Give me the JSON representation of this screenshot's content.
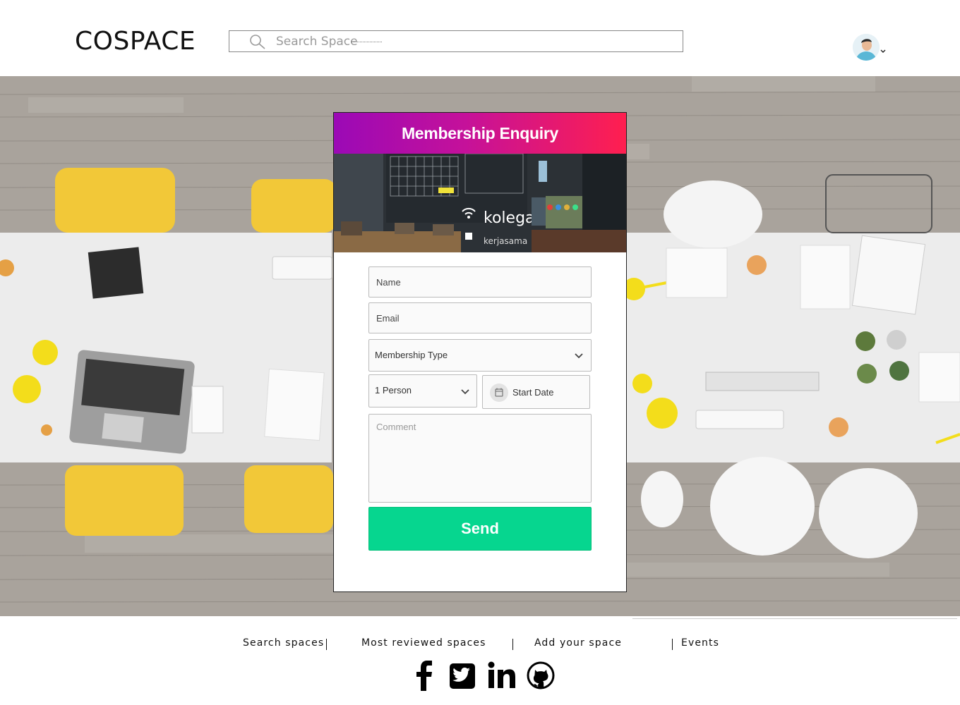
{
  "header": {
    "logo": "COSPACE",
    "search_placeholder": "Search Space"
  },
  "form": {
    "title": "Membership Enquiry",
    "photo_sign_text": "kolega",
    "photo_sign_subtext": "kerjasama",
    "name_placeholder": "Name",
    "email_placeholder": "Email",
    "membership_type": "Membership Type",
    "persons": "1 Person",
    "start_date": "Start Date",
    "comment_placeholder": "Comment",
    "send_label": "Send"
  },
  "footer": {
    "links": [
      "Search spaces",
      "Most reviewed spaces",
      "Add your space",
      "Events"
    ],
    "social": [
      "facebook-icon",
      "twitter-icon",
      "linkedin-icon",
      "github-icon"
    ]
  },
  "colors": {
    "gradient_start": "#9b09b6",
    "gradient_end": "#ff1f4f",
    "send_button": "#06d68f"
  }
}
